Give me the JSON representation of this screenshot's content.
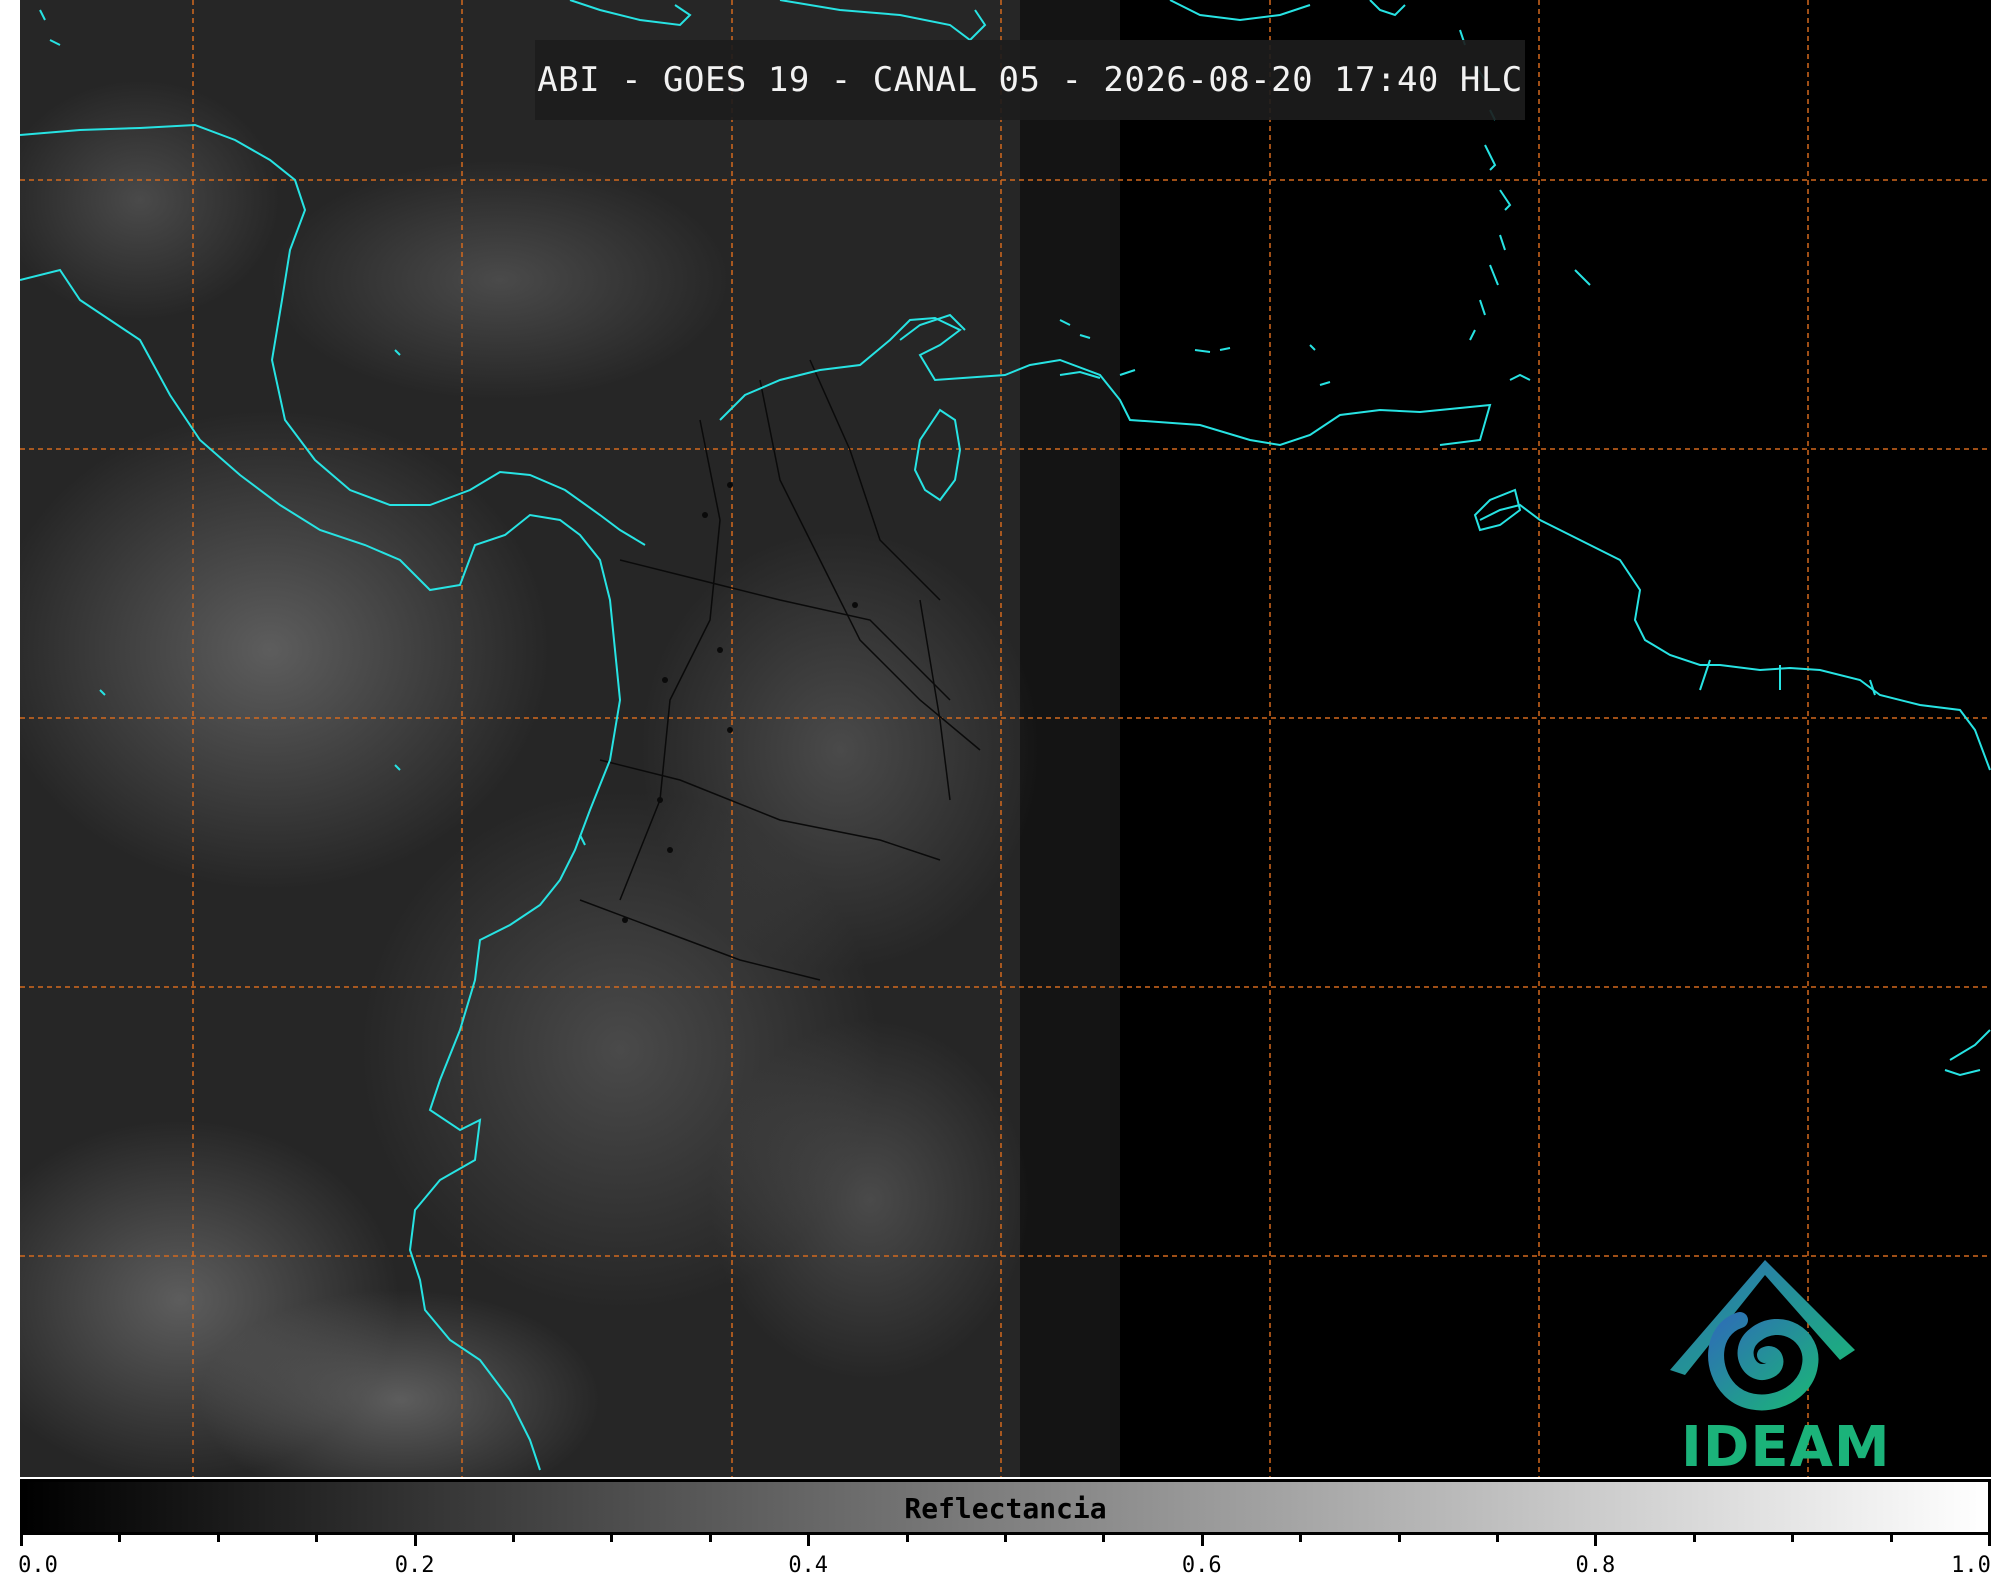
{
  "title": "ABI - GOES 19 - CANAL 05 - 2026-08-20 17:40 HLC",
  "logo_text": "IDEAM",
  "colorbar": {
    "label": "Reflectancia",
    "range": [
      0.0,
      1.0
    ],
    "gradient": [
      "#000000",
      "#ffffff"
    ],
    "major_ticks": [
      "0.0",
      "0.2",
      "0.4",
      "0.6",
      "0.8",
      "1.0"
    ],
    "minor_tick_step": 0.05
  },
  "colors": {
    "coastline": "#27e3e3",
    "graticule": "#d2691e",
    "background": "#000000",
    "logo_teal": "#1bb37a",
    "logo_blue": "#2d6fb5"
  }
}
